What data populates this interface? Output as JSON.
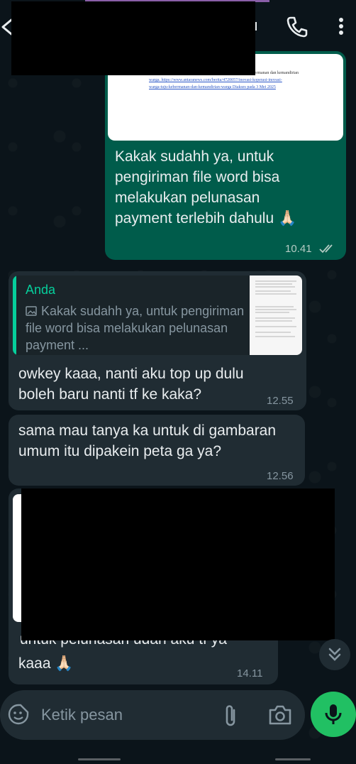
{
  "header": {
    "contact_name": ""
  },
  "messages": {
    "outgoing_1": {
      "text": "Kakak sudahh ya, untuk pengiriman file word bisa melakukan pelunasan payment terlebih dahulu 🙏🏻",
      "time": "10.41",
      "status": "read"
    },
    "doc_preview_lines": [
      "kebermanan dan kemandirian",
      "warga.   https://www.antaranews.com/berita/4720057/inovasi-koperasi-inovasi-",
      "warga-tuju-kebermanan-dan-kemandirian-warga   Diakses pada 3 Mei 2025"
    ],
    "incoming_1": {
      "quote_author": "Anda",
      "quote_text": "Kakak sudahh ya, untuk pengiriman file word bisa melakukan pelunasan payment ...",
      "text": "owkey kaaa, nanti aku top up dulu boleh baru nanti tf ke kaka?",
      "time": "12.55"
    },
    "incoming_2": {
      "text": "sama mau tanya ka untuk di gambaran umum itu dipakein peta ga ya?",
      "time": "12.56"
    },
    "incoming_3": {
      "text_partial": "untuk pelunasan udah aku tf ya",
      "text": "kaaa 🙏🏻",
      "time": "14.11"
    }
  },
  "composer": {
    "placeholder": "Ketik pesan"
  },
  "icons": {
    "back": "arrow-left-icon",
    "call": "phone-icon",
    "menu": "more-vert-icon",
    "emoji": "sticker-icon",
    "attach": "paperclip-icon",
    "camera": "camera-icon",
    "mic": "mic-icon",
    "scroll": "double-chevron-down-icon",
    "image": "image-icon"
  },
  "colors": {
    "outgoing_bubble": "#005c4b",
    "incoming_bubble": "#202c33",
    "accent": "#06cf9c",
    "mic_button": "#21c063"
  }
}
